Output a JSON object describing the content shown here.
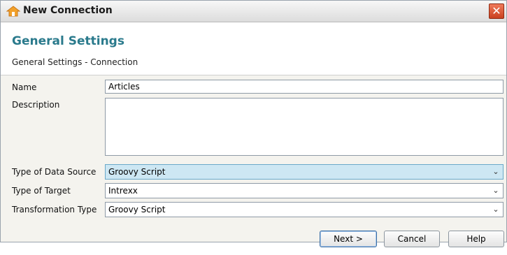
{
  "window": {
    "title": "New Connection",
    "close_glyph": "✕"
  },
  "header": {
    "title": "General Settings",
    "subtitle": "General Settings - Connection"
  },
  "form": {
    "name_label": "Name",
    "name_value": "Articles",
    "description_label": "Description",
    "description_value": "",
    "data_source_label": "Type of Data Source",
    "data_source_value": "Groovy Script",
    "target_label": "Type of Target",
    "target_value": "Intrexx",
    "transformation_label": "Transformation Type",
    "transformation_value": "Groovy Script",
    "dropdown_glyph": "⌄"
  },
  "buttons": {
    "next": "Next >",
    "cancel": "Cancel",
    "help": "Help"
  },
  "colors": {
    "accent": "#2a7a8c",
    "selected_field": "#cde7f3",
    "close": "#d4532f"
  },
  "icons": {
    "app": "home-icon",
    "close": "close-icon",
    "dropdown": "chevron-down-icon"
  }
}
